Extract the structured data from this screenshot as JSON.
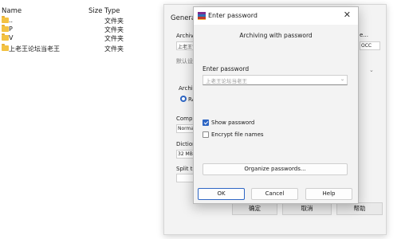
{
  "explorer": {
    "columns": {
      "name": "Name",
      "size": "Size",
      "type": "Type"
    },
    "rows": [
      {
        "name": "..",
        "type": "文件夹"
      },
      {
        "name": "P",
        "type": "文件夹"
      },
      {
        "name": "V",
        "type": "文件夹"
      },
      {
        "name": "上老王论坛当老王",
        "type": "文件夹"
      }
    ]
  },
  "archive_dialog": {
    "tab_general": "General",
    "archive_label": "Archive",
    "archive_value": "上老王论坛",
    "default_label": "默认设",
    "browse_fragment": "e...",
    "format_fragment": "OCC",
    "archive_format_label": "Archive",
    "radio_fragment": "RA",
    "compression_label": "Compre",
    "compression_value": "Norma",
    "dictionary_label": "Diction",
    "dictionary_value": "32 MB",
    "split_label": "Split to",
    "ok": "确定",
    "cancel": "取消",
    "help": "帮助"
  },
  "password_dialog": {
    "title": "Enter password",
    "heading": "Archiving with password",
    "password_label": "Enter password",
    "password_value": "上老王论坛当老王",
    "show_password": {
      "label": "Show password",
      "checked": true
    },
    "encrypt_names": {
      "label": "Encrypt file names",
      "checked": false
    },
    "organize_button": "Organize passwords...",
    "ok_button": "OK",
    "cancel_button": "Cancel",
    "help_button": "Help"
  },
  "colors": {
    "accent": "#2e66c4",
    "folder": "#f3c242",
    "dialog_bg": "#f3f3f3"
  },
  "icons": {
    "folder": "folder-icon",
    "app": "winrar-icon",
    "close": "close-icon",
    "dropdown": "chevron-down-icon"
  }
}
